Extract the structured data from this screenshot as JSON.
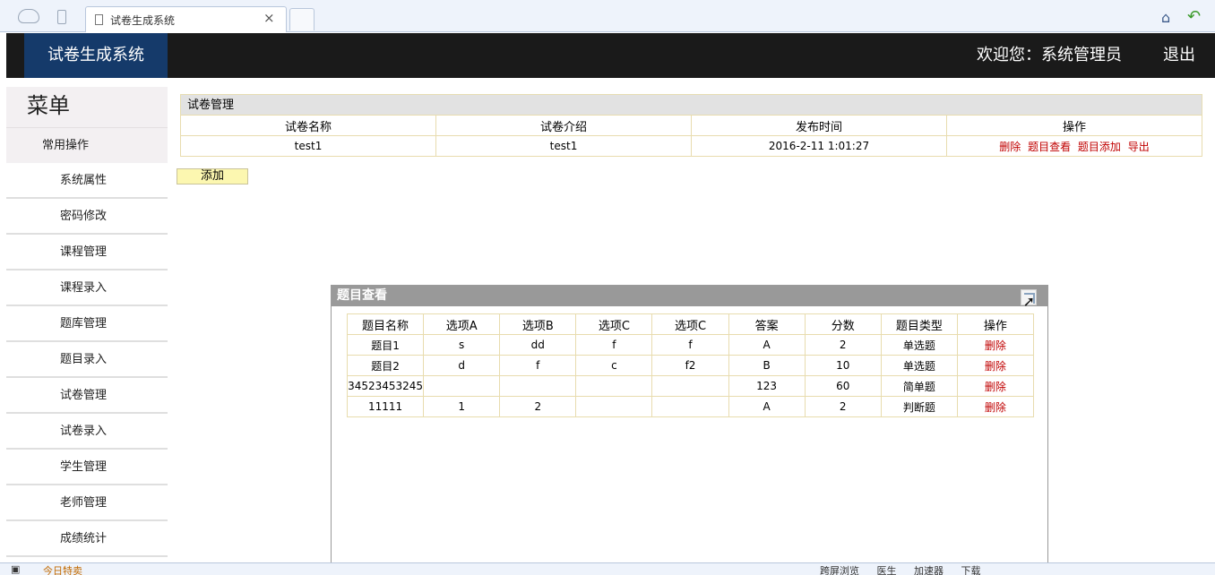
{
  "browser": {
    "tab_title": "试卷生成系统",
    "close_glyph": "×"
  },
  "header": {
    "app_title": "试卷生成系统",
    "welcome": "欢迎您：系统管理员",
    "logout": "退出"
  },
  "sidebar": {
    "heading": "菜单",
    "group": "常用操作",
    "items": [
      {
        "label": "系统属性"
      },
      {
        "label": "密码修改"
      },
      {
        "label": "课程管理"
      },
      {
        "label": "课程录入"
      },
      {
        "label": "题库管理"
      },
      {
        "label": "题目录入"
      },
      {
        "label": "试卷管理"
      },
      {
        "label": "试卷录入"
      },
      {
        "label": "学生管理"
      },
      {
        "label": "老师管理"
      },
      {
        "label": "成绩统计"
      }
    ]
  },
  "exam_panel": {
    "title": "试卷管理",
    "columns": [
      "试卷名称",
      "试卷介绍",
      "发布时间",
      "操作"
    ],
    "rows": [
      {
        "name": "test1",
        "intro": "test1",
        "time": "2016-2-11 1:01:27",
        "actions": [
          "删除",
          "题目查看",
          "题目添加",
          "导出"
        ]
      }
    ],
    "add_button": "添加"
  },
  "dialog": {
    "title": "题目查看",
    "columns": [
      "题目名称",
      "选项A",
      "选项B",
      "选项C",
      "选项C",
      "答案",
      "分数",
      "题目类型",
      "操作"
    ],
    "rows": [
      {
        "name": "题目1",
        "a": "s",
        "b": "dd",
        "c": "f",
        "d": "f",
        "answer": "A",
        "score": "2",
        "type": "单选题",
        "action": "删除"
      },
      {
        "name": "题目2",
        "a": "d",
        "b": "f",
        "c": "c",
        "d": "f2",
        "answer": "B",
        "score": "10",
        "type": "单选题",
        "action": "删除"
      },
      {
        "name": "34523453245",
        "a": "",
        "b": "",
        "c": "",
        "d": "",
        "answer": "123",
        "score": "60",
        "type": "简单题",
        "action": "删除"
      },
      {
        "name": "11111",
        "a": "1",
        "b": "2",
        "c": "",
        "d": "",
        "answer": "A",
        "score": "2",
        "type": "判断题",
        "action": "删除"
      }
    ]
  },
  "status_bar": {
    "left": "今日特卖",
    "right": [
      "跨屏浏览",
      "医生",
      "加速器",
      "下载"
    ]
  }
}
